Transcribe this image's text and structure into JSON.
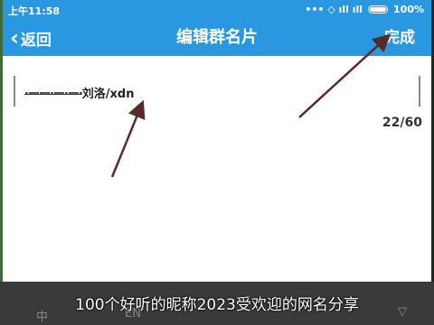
{
  "status_bar": {
    "time": "上午11:58",
    "indicators": "••• ◇ ıll ıll",
    "battery": "100%"
  },
  "header": {
    "back_label": "返回",
    "back_icon": "chevron-left-icon",
    "title": "编辑群名片",
    "done_label": "完成"
  },
  "form": {
    "nickname_prefix": "·ーー·ー·ー·",
    "nickname_value": "刘洛/xdn",
    "counter": "22/60"
  },
  "keyboard": {
    "key_left": "中",
    "key_mid": "EN",
    "key_right": "▽"
  },
  "caption": "100个好听的昵称2023受欢迎的网名分享",
  "colors": {
    "accent": "#2a98e0",
    "arrow": "#5a2a2a"
  }
}
